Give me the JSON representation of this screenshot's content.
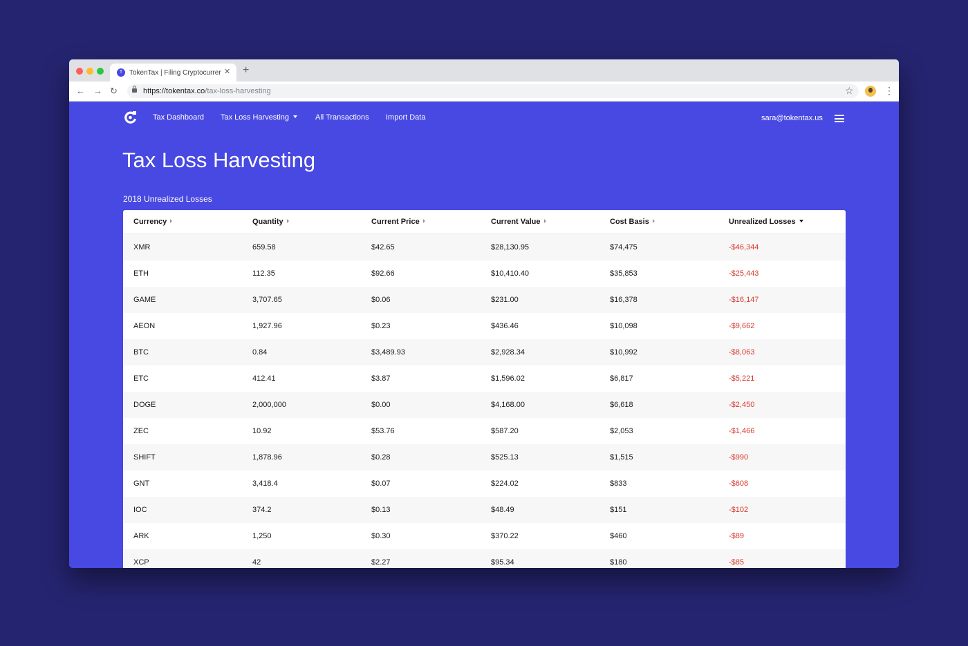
{
  "browser": {
    "tab_title": "TokenTax | Filing Cryptocurrency Taxes",
    "tab_favicon": "T",
    "url_host": "https://tokentax.co",
    "url_path": "/tax-loss-harvesting",
    "icons": [
      "back-arrow-icon",
      "forward-arrow-icon",
      "reload-icon",
      "lock-icon",
      "star-icon",
      "avatar",
      "menu-dots-icon",
      "close-icon",
      "plus-icon"
    ]
  },
  "nav": {
    "items": [
      {
        "label": "Tax Dashboard"
      },
      {
        "label": "Tax Loss Harvesting"
      },
      {
        "label": "All Transactions"
      },
      {
        "label": "Import Data"
      }
    ],
    "user_email": "sara@tokentax.us"
  },
  "page": {
    "title": "Tax Loss Harvesting",
    "section_title": "2018 Unrealized Losses"
  },
  "table": {
    "columns": [
      "Currency",
      "Quantity",
      "Current Price",
      "Current Value",
      "Cost Basis",
      "Unrealized Losses"
    ],
    "sorted_column": "Unrealized Losses",
    "rows": [
      [
        "XMR",
        "659.58",
        "$42.65",
        "$28,130.95",
        "$74,475",
        "-$46,344"
      ],
      [
        "ETH",
        "112.35",
        "$92.66",
        "$10,410.40",
        "$35,853",
        "-$25,443"
      ],
      [
        "GAME",
        "3,707.65",
        "$0.06",
        "$231.00",
        "$16,378",
        "-$16,147"
      ],
      [
        "AEON",
        "1,927.96",
        "$0.23",
        "$436.46",
        "$10,098",
        "-$9,662"
      ],
      [
        "BTC",
        "0.84",
        "$3,489.93",
        "$2,928.34",
        "$10,992",
        "-$8,063"
      ],
      [
        "ETC",
        "412.41",
        "$3.87",
        "$1,596.02",
        "$6,817",
        "-$5,221"
      ],
      [
        "DOGE",
        "2,000,000",
        "$0.00",
        "$4,168.00",
        "$6,618",
        "-$2,450"
      ],
      [
        "ZEC",
        "10.92",
        "$53.76",
        "$587.20",
        "$2,053",
        "-$1,466"
      ],
      [
        "SHIFT",
        "1,878.96",
        "$0.28",
        "$525.13",
        "$1,515",
        "-$990"
      ],
      [
        "GNT",
        "3,418.4",
        "$0.07",
        "$224.02",
        "$833",
        "-$608"
      ],
      [
        "IOC",
        "374.2",
        "$0.13",
        "$48.49",
        "$151",
        "-$102"
      ],
      [
        "ARK",
        "1,250",
        "$0.30",
        "$370.22",
        "$460",
        "-$89"
      ],
      [
        "XCP",
        "42",
        "$2.27",
        "$95.34",
        "$180",
        "-$85"
      ]
    ]
  },
  "colors": {
    "background": "#252470",
    "brand": "#4848e2",
    "loss": "#d9392f"
  }
}
